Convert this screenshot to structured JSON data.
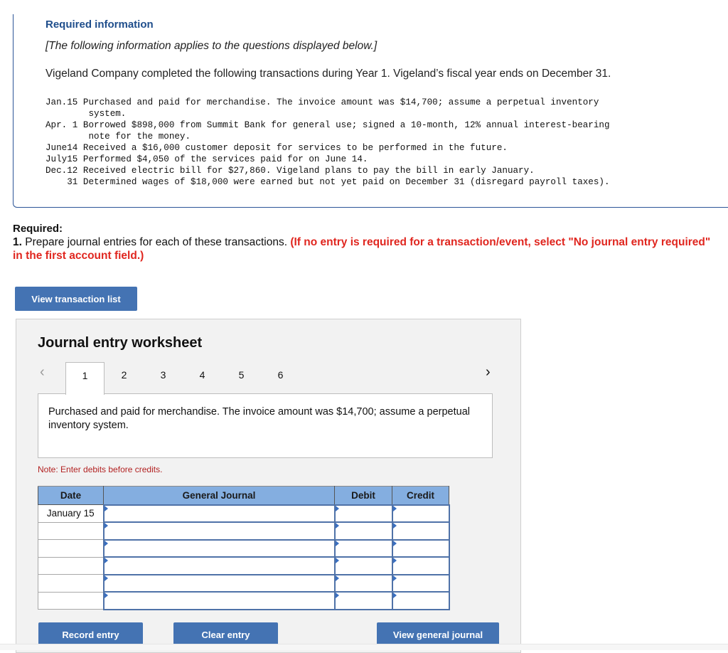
{
  "info": {
    "title": "Required information",
    "italic_note": "[The following information applies to the questions displayed below.]",
    "intro": "Vigeland Company completed the following transactions during Year 1. Vigeland’s fiscal year ends on December 31.",
    "transactions": [
      {
        "date": "Jan.15",
        "text": "Purchased and paid for merchandise. The invoice amount was $14,700; assume a perpetual inventory\n        system."
      },
      {
        "date": "Apr. 1",
        "text": "Borrowed $898,000 from Summit Bank for general use; signed a 10-month, 12% annual interest-bearing\n        note for the money."
      },
      {
        "date": "June14",
        "text": "Received a $16,000 customer deposit for services to be performed in the future."
      },
      {
        "date": "July15",
        "text": "Performed $4,050 of the services paid for on June 14."
      },
      {
        "date": "Dec.12",
        "text": "Received electric bill for $27,860. Vigeland plans to pay the bill in early January."
      },
      {
        "date": "    31",
        "text": "Determined wages of $18,000 were earned but not yet paid on December 31 (disregard payroll taxes)."
      }
    ]
  },
  "required": {
    "label": "Required:",
    "number": "1.",
    "text": " Prepare journal entries for each of these transactions. ",
    "red_text": "(If no entry is required for a transaction/event, select \"No journal entry required\" in the first account field.)"
  },
  "buttons": {
    "view_transaction_list": "View transaction list",
    "record_entry": "Record entry",
    "clear_entry": "Clear entry",
    "view_general_journal": "View general journal"
  },
  "worksheet": {
    "title": "Journal entry worksheet",
    "prev_icon": "‹",
    "next_icon": "›",
    "tabs": [
      "1",
      "2",
      "3",
      "4",
      "5",
      "6"
    ],
    "active_tab": "1",
    "description": "Purchased and paid for merchandise. The invoice amount was $14,700; assume a perpetual inventory system.",
    "note": "Note: Enter debits before credits.",
    "table": {
      "headers": [
        "Date",
        "General Journal",
        "Debit",
        "Credit"
      ],
      "rows": [
        {
          "date": "January 15",
          "account": "",
          "debit": "",
          "credit": ""
        },
        {
          "date": "",
          "account": "",
          "debit": "",
          "credit": ""
        },
        {
          "date": "",
          "account": "",
          "debit": "",
          "credit": ""
        },
        {
          "date": "",
          "account": "",
          "debit": "",
          "credit": ""
        },
        {
          "date": "",
          "account": "",
          "debit": "",
          "credit": ""
        },
        {
          "date": "",
          "account": "",
          "debit": "",
          "credit": ""
        }
      ]
    }
  },
  "colors": {
    "accent_blue": "#4473b3",
    "header_blue": "#84aee0",
    "title_blue": "#1f4e8c",
    "alert_red": "#e0261f",
    "note_red": "#b22222"
  }
}
